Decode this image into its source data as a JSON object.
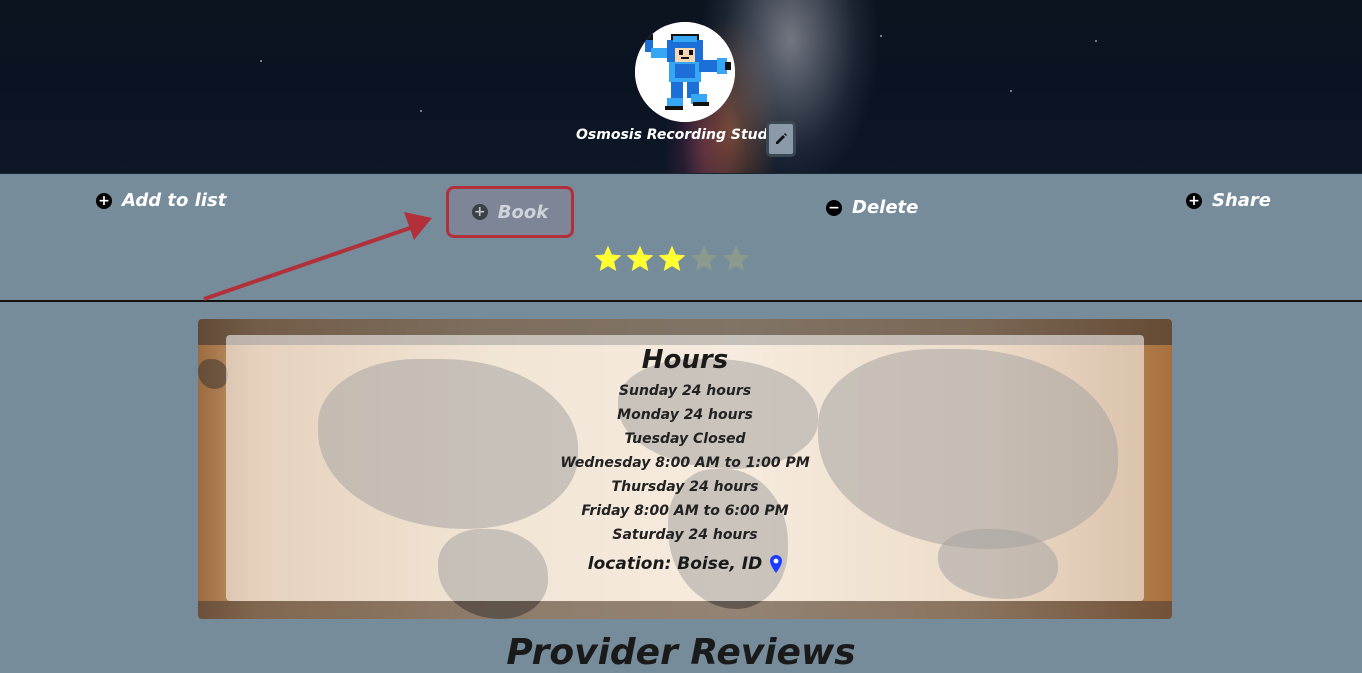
{
  "header": {
    "studio_name": "Osmosis Recording Studio"
  },
  "actions": {
    "add_to_list": "Add to list",
    "book": "Book",
    "delete": "Delete",
    "share": "Share"
  },
  "rating": {
    "value": 3,
    "max": 5
  },
  "hours": {
    "title": "Hours",
    "days": [
      "Sunday 24 hours",
      "Monday 24 hours",
      "Tuesday Closed",
      "Wednesday 8:00 AM to 1:00 PM",
      "Thursday 24 hours",
      "Friday 8:00 AM to 6:00 PM",
      "Saturday 24 hours"
    ],
    "location": "location: Boise, ID"
  },
  "reviews": {
    "title": "Provider Reviews"
  },
  "icons": {
    "edit": "pencil-icon",
    "add": "plus-circle-icon",
    "delete": "minus-circle-icon",
    "location": "map-pin-icon",
    "star": "star-icon",
    "avatar": "mega-man-avatar"
  },
  "colors": {
    "page_bg": "#778c9a",
    "star_filled": "#ffff33",
    "star_empty": "#8a9a8c",
    "highlight": "#b23039",
    "pin": "#1a3cff"
  }
}
